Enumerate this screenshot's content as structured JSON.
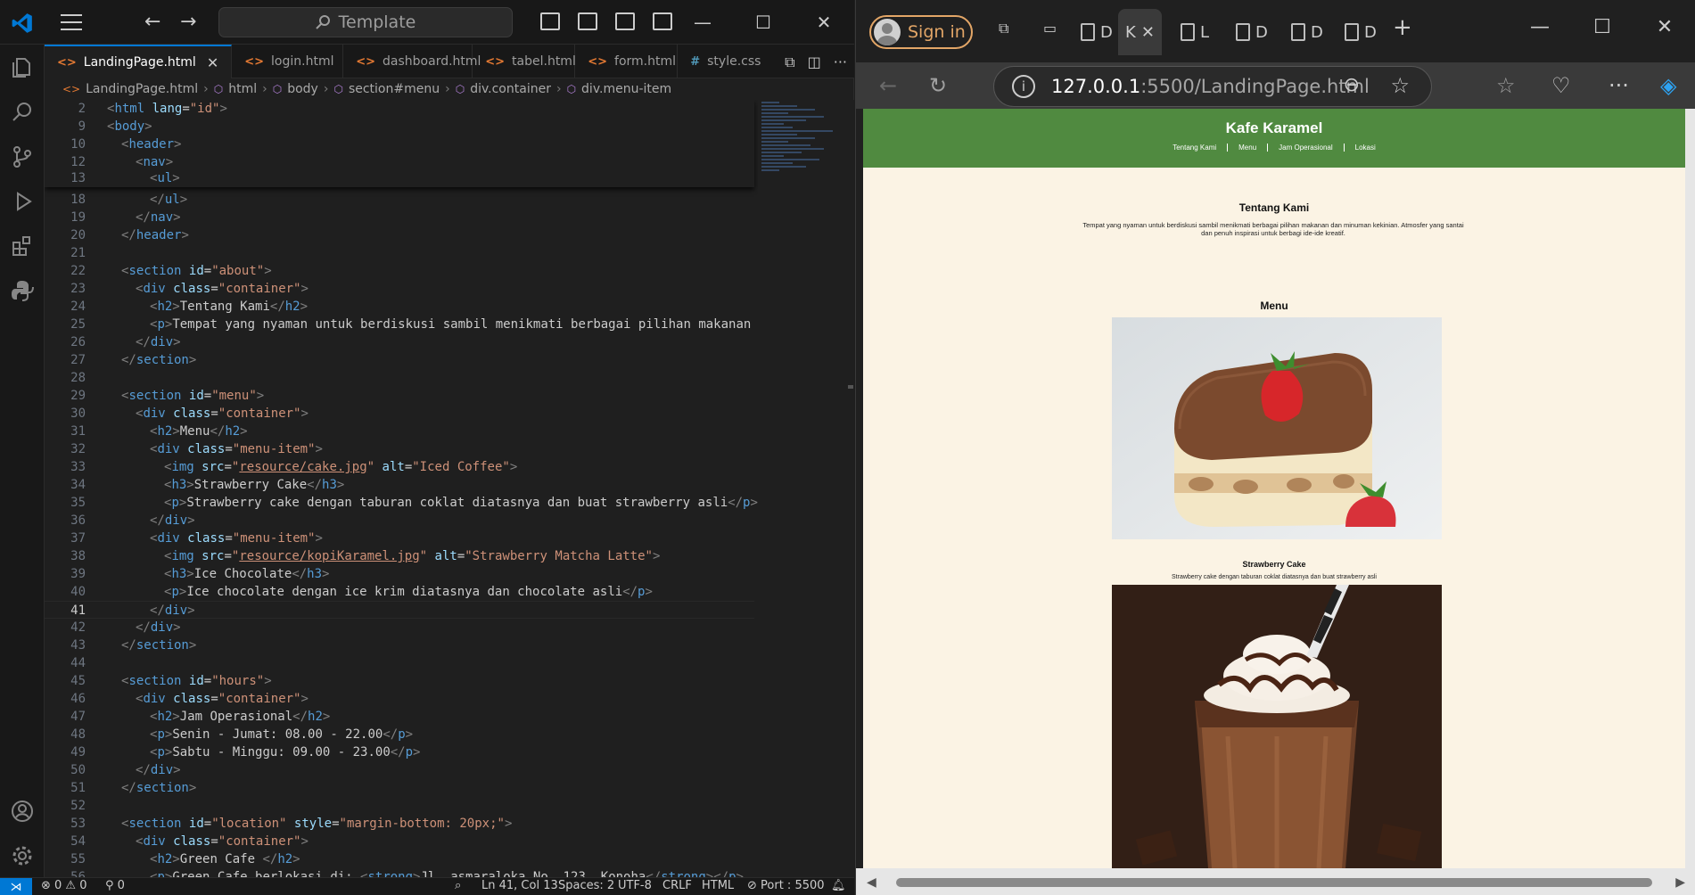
{
  "vscode": {
    "search_label": "Template",
    "tabs": [
      {
        "label": "LandingPage.html",
        "kind": "html",
        "active": true
      },
      {
        "label": "login.html",
        "kind": "html"
      },
      {
        "label": "dashboard.html",
        "kind": "html"
      },
      {
        "label": "tabel.html",
        "kind": "html"
      },
      {
        "label": "form.html",
        "kind": "html"
      },
      {
        "label": "style.css",
        "kind": "css"
      }
    ],
    "breadcrumb": [
      "LandingPage.html",
      "html",
      "body",
      "section#menu",
      "div.container",
      "div.menu-item"
    ],
    "current_line": 41,
    "status": {
      "problems": "⊗ 0 ⚠ 0",
      "ports": "⚲ 0",
      "position": "Ln 41, Col 13",
      "spaces": "Spaces: 2",
      "encoding": "UTF-8",
      "eol": "CRLF",
      "language": "HTML",
      "port": "⊘ Port : 5500"
    }
  },
  "browser": {
    "signin_label": "Sign in",
    "tabs": [
      "D",
      "K",
      "L",
      "D",
      "D",
      "D"
    ],
    "url_host": "127.0.0.1",
    "url_rest": ":5500/LandingPage.html"
  },
  "site": {
    "title": "Kafe Karamel",
    "nav": [
      "Tentang Kami",
      "Menu",
      "Jam Operasional",
      "Lokasi"
    ],
    "about_title": "Tentang Kami",
    "about_text": "Tempat yang nyaman untuk berdiskusi sambil menikmati berbagai pilihan makanan dan minuman kekinian. Atmosfer yang santai dan penuh inspirasi untuk berbagi ide-ide kreatif.",
    "menu_title": "Menu",
    "items": [
      {
        "title": "Strawberry Cake",
        "desc": "Strawberry cake dengan taburan coklat diatasnya dan buat strawberry asli"
      }
    ]
  },
  "colors": {
    "site_header": "#508a40",
    "site_bg": "#fbf3e4",
    "vscode_accent": "#0078d4",
    "signin_accent": "#e3a667"
  }
}
